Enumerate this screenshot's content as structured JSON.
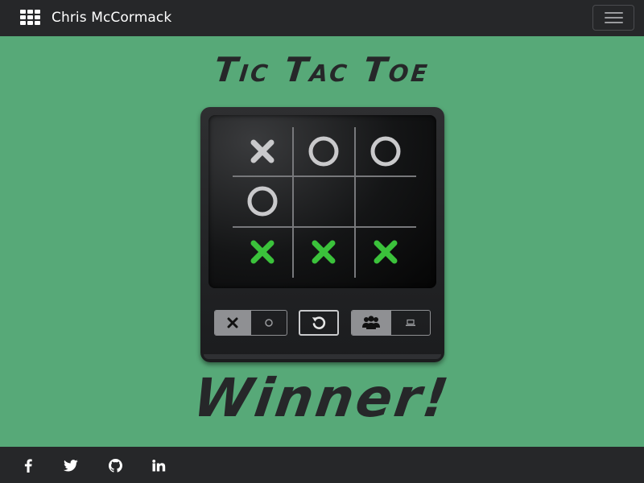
{
  "navbar": {
    "brand": "Chris McCormack",
    "brand_icon": "apps-grid-icon",
    "menu_icon": "hamburger-menu-icon"
  },
  "game": {
    "title": "Tic Tac Toe",
    "board": [
      [
        "X",
        "O",
        "O"
      ],
      [
        "O",
        "",
        ""
      ],
      [
        "X",
        "X",
        "X"
      ]
    ],
    "winning_row": 2,
    "colors": {
      "background": "#57a978",
      "mark": "#c9c9cb",
      "winning_mark": "#3bc23b",
      "device": "#262729"
    },
    "player_toggle": {
      "options": [
        "x-icon",
        "o-icon"
      ],
      "selected": "x-icon"
    },
    "reset_icon": "reset-icon",
    "mode_toggle": {
      "options": [
        "users-icon",
        "laptop-icon"
      ],
      "selected": "users-icon"
    },
    "status": "Winner!"
  },
  "footer": {
    "social_icons": [
      "facebook-icon",
      "twitter-icon",
      "github-icon",
      "linkedin-icon"
    ]
  }
}
